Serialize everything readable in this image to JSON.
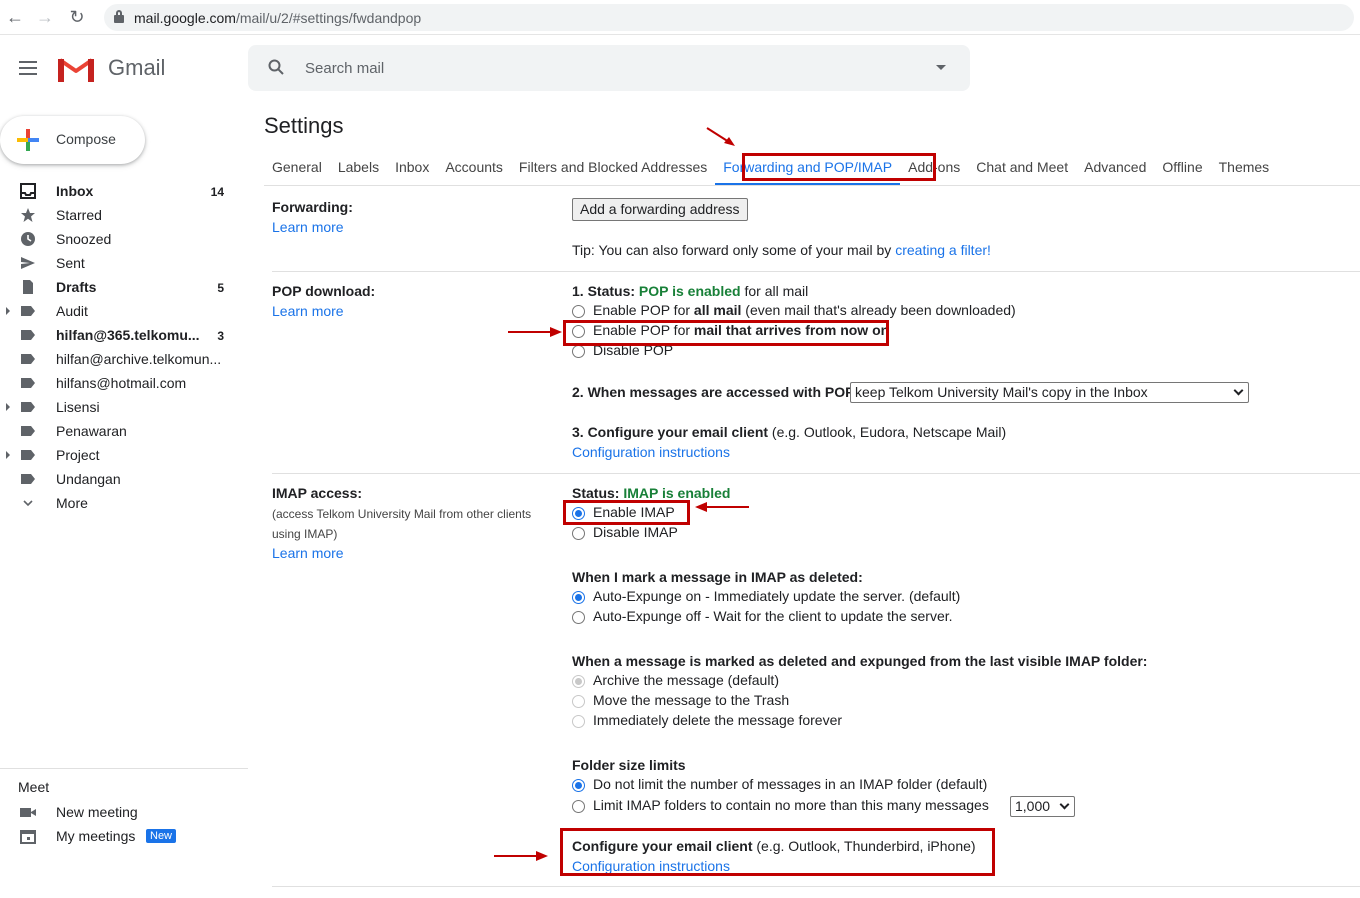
{
  "browser": {
    "url_host": "mail.google.com",
    "url_path": "/mail/u/2/#settings/fwdandpop"
  },
  "header": {
    "brand": "Gmail",
    "search_placeholder": "Search mail"
  },
  "sidebar": {
    "compose_label": "Compose",
    "items": [
      {
        "label": "Inbox",
        "count": "14",
        "bold": true,
        "icon": "inbox-icon"
      },
      {
        "label": "Starred",
        "count": "",
        "icon": "star-icon"
      },
      {
        "label": "Snoozed",
        "count": "",
        "icon": "clock-icon"
      },
      {
        "label": "Sent",
        "count": "",
        "icon": "send-icon"
      },
      {
        "label": "Drafts",
        "count": "5",
        "bold": true,
        "icon": "draft-icon"
      },
      {
        "label": "Audit",
        "count": "",
        "icon": "label-icon",
        "expandable": true
      },
      {
        "label": "hilfan@365.telkomu...",
        "count": "3",
        "bold": true,
        "icon": "label-icon"
      },
      {
        "label": "hilfan@archive.telkomun...",
        "count": "",
        "icon": "label-icon"
      },
      {
        "label": "hilfans@hotmail.com",
        "count": "",
        "icon": "label-icon"
      },
      {
        "label": "Lisensi",
        "count": "",
        "icon": "label-icon",
        "expandable": true
      },
      {
        "label": "Penawaran",
        "count": "",
        "icon": "label-icon"
      },
      {
        "label": "Project",
        "count": "",
        "icon": "label-icon",
        "expandable": true
      },
      {
        "label": "Undangan",
        "count": "",
        "icon": "label-icon"
      },
      {
        "label": "More",
        "count": "",
        "icon": "chevron-down-icon"
      }
    ],
    "meet": {
      "title": "Meet",
      "new_meeting": "New meeting",
      "my_meetings": "My meetings",
      "new_badge": "New"
    }
  },
  "settings": {
    "title": "Settings",
    "tabs": [
      "General",
      "Labels",
      "Inbox",
      "Accounts",
      "Filters and Blocked Addresses",
      "Forwarding and POP/IMAP",
      "Add-ons",
      "Chat and Meet",
      "Advanced",
      "Offline",
      "Themes"
    ],
    "active_tab": "Forwarding and POP/IMAP",
    "forwarding": {
      "label": "Forwarding:",
      "learn_more": "Learn more",
      "add_button": "Add a forwarding address",
      "tip_prefix": "Tip: You can also forward only some of your mail by ",
      "tip_link": "creating a filter!"
    },
    "pop": {
      "label": "POP download:",
      "learn_more": "Learn more",
      "status_prefix": "1. Status: ",
      "status_value": "POP is enabled",
      "status_suffix": " for all mail",
      "opt1_prefix": "Enable POP for ",
      "opt1_bold": "all mail",
      "opt1_suffix": " (even mail that's already been downloaded)",
      "opt2_prefix": "Enable POP for ",
      "opt2_bold": "mail that arrives from now on",
      "opt3": "Disable POP",
      "q2_label": "2. When messages are accessed with POP",
      "q2_value": "keep Telkom University Mail's copy in the Inbox",
      "q3_bold": "3. Configure your email client",
      "q3_suffix": " (e.g. Outlook, Eudora, Netscape Mail)",
      "config_link": "Configuration instructions"
    },
    "imap": {
      "label": "IMAP access:",
      "description": "(access Telkom University Mail from other clients using IMAP)",
      "learn_more": "Learn more",
      "status_prefix": "Status: ",
      "status_value": "IMAP is enabled",
      "enable": "Enable IMAP",
      "disable": "Disable IMAP",
      "deleted_title": "When I mark a message in IMAP as deleted:",
      "expunge_on": "Auto-Expunge on - Immediately update the server. (default)",
      "expunge_off": "Auto-Expunge off - Wait for the client to update the server.",
      "expunged_title": "When a message is marked as deleted and expunged from the last visible IMAP folder:",
      "archive": "Archive the message (default)",
      "trash": "Move the message to the Trash",
      "delete_forever": "Immediately delete the message forever",
      "folder_title": "Folder size limits",
      "no_limit": "Do not limit the number of messages in an IMAP folder (default)",
      "limit": "Limit IMAP folders to contain no more than this many messages",
      "limit_value": "1,000",
      "client_bold": "Configure your email client",
      "client_suffix": " (e.g. Outlook, Thunderbird, iPhone)",
      "config_link": "Configuration instructions"
    }
  },
  "colors": {
    "accent": "#1a73e8",
    "status_green": "#188038",
    "annotation_red": "#c00000"
  }
}
